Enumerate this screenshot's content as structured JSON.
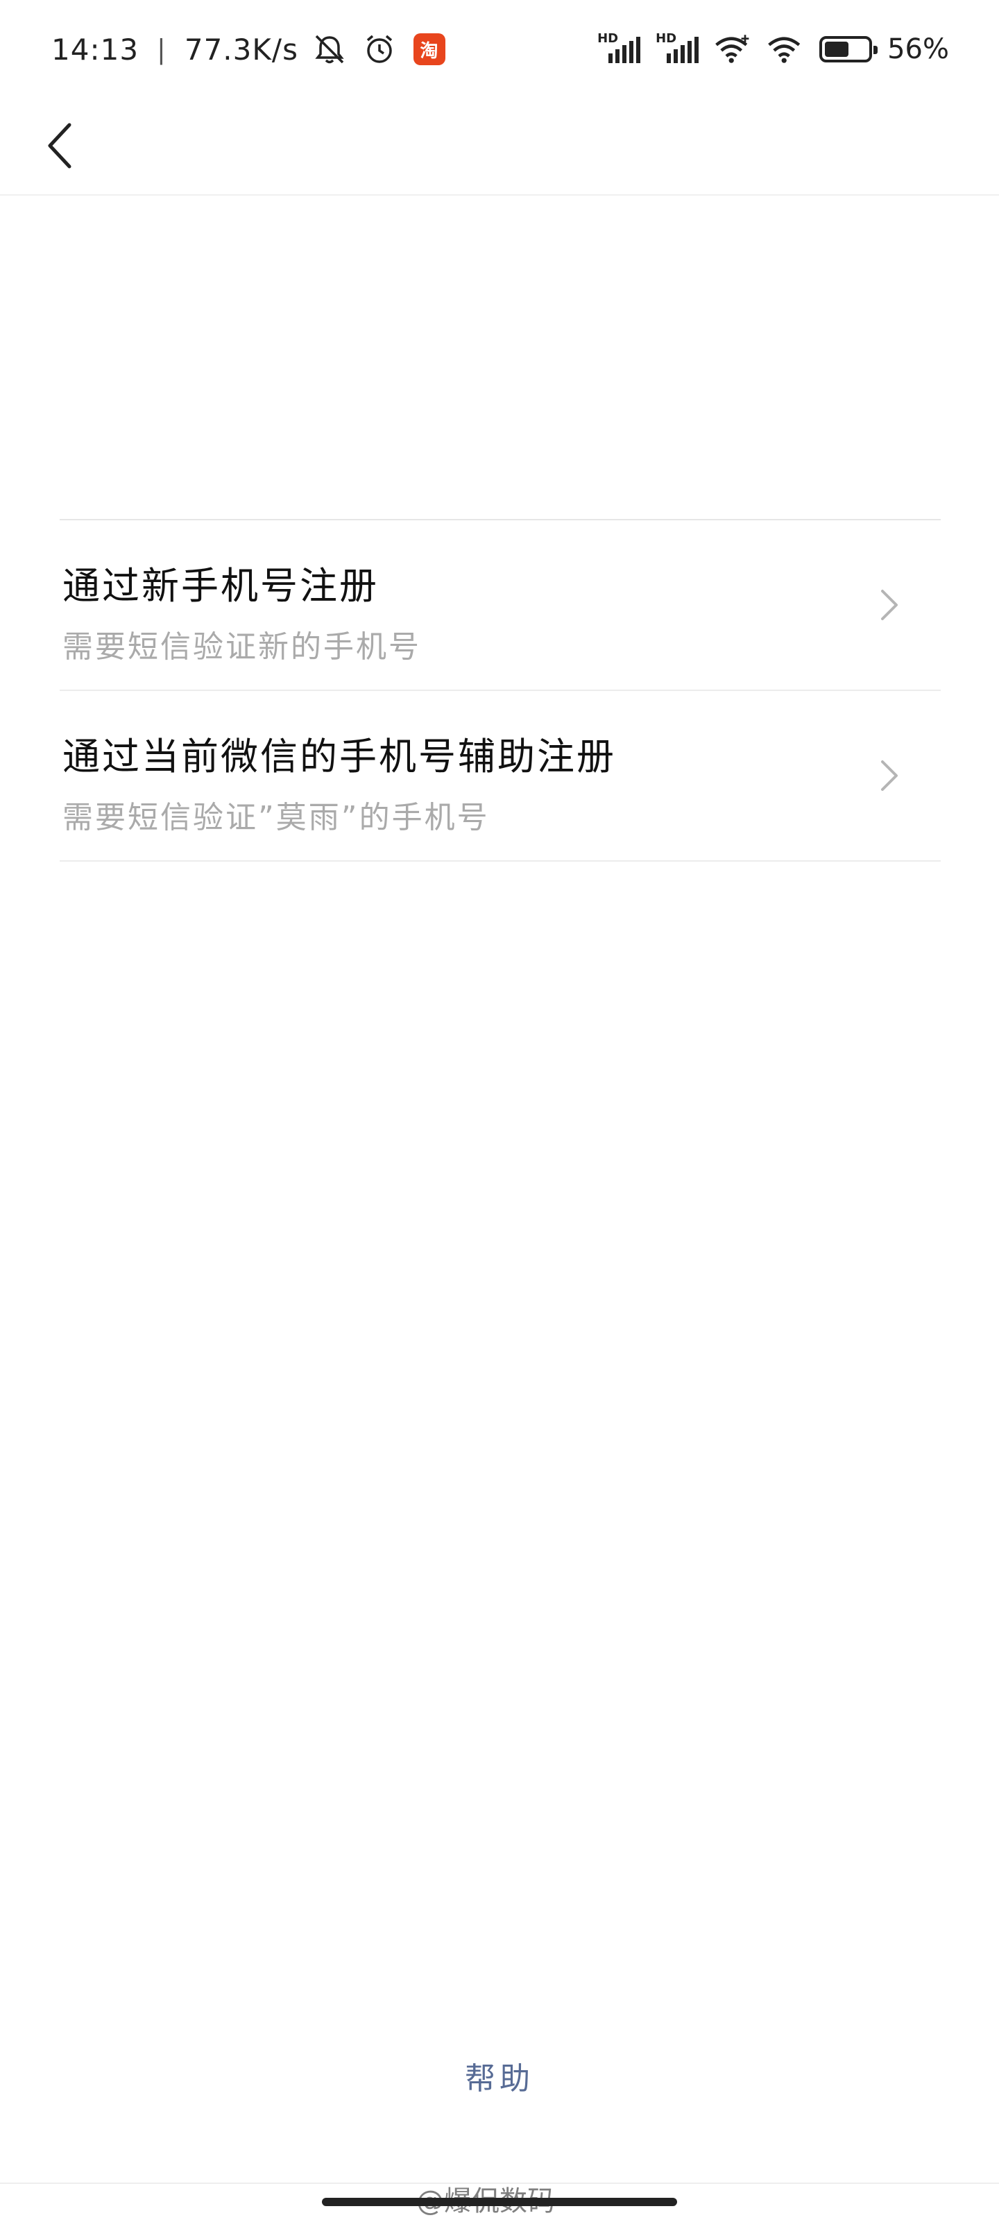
{
  "status_bar": {
    "time": "14:13",
    "separator": "|",
    "speed": "77.3K/s",
    "battery": "56%",
    "battery_level": 0.56,
    "hd_label": "HD",
    "taobao_label": "淘"
  },
  "nav": {
    "back_icon": "chevron-left-icon"
  },
  "options": [
    {
      "title": "通过新手机号注册",
      "subtitle": "需要短信验证新的手机号"
    },
    {
      "title": "通过当前微信的手机号辅助注册",
      "subtitle": "需要短信验证”莫雨”的手机号"
    }
  ],
  "footer": {
    "help": "帮助",
    "watermark": "@爆侃数码"
  },
  "colors": {
    "link": "#576b95",
    "subtitle": "#aaaaaa",
    "taobao": "#e8451d"
  }
}
